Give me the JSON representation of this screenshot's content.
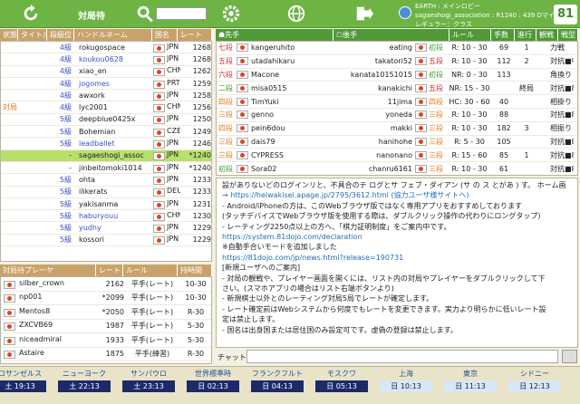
{
  "toolbar": {
    "title": "対局待",
    "status_line1": "EARTH : メインロビー",
    "status_line2": "sagaeshogi_association : R1240 : 439 Dマイル :",
    "status_line3": "レギュラー：クラス",
    "logo": "81"
  },
  "players_table": {
    "headers": [
      "状態",
      "タイトル",
      "段級位",
      "ハンドルネーム",
      "国名",
      "レート"
    ],
    "rows": [
      {
        "status": "",
        "title": "",
        "rank": "4級",
        "rank_color": "blue",
        "name": "rokugospace",
        "country": "JPN",
        "rate": "1268"
      },
      {
        "status": "",
        "title": "",
        "rank": "4級",
        "rank_color": "blue",
        "name": "koukou0628",
        "country": "JPN",
        "rate": "1268",
        "name_color": "blue"
      },
      {
        "status": "",
        "title": "",
        "rank": "4級",
        "rank_color": "blue",
        "name": "xiao_en",
        "country": "CHN",
        "rate": "1262"
      },
      {
        "status": "",
        "title": "",
        "rank": "4級",
        "rank_color": "blue",
        "name": "jogomes",
        "country": "PRT",
        "rate": "1259",
        "name_color": "blue"
      },
      {
        "status": "",
        "title": "",
        "rank": "4級",
        "rank_color": "blue",
        "name": "awxork",
        "country": "JPN",
        "rate": "1258"
      },
      {
        "status": "対局",
        "title": "",
        "rank": "4級",
        "rank_color": "blue",
        "name": "lyc2001",
        "country": "CHN",
        "rate": "1256"
      },
      {
        "status": "",
        "title": "",
        "rank": "5級",
        "rank_color": "blue",
        "name": "deepblue0425x",
        "country": "JPN",
        "rate": "1250"
      },
      {
        "status": "",
        "title": "",
        "rank": "5級",
        "rank_color": "blue",
        "name": "Bohemian",
        "country": "CZE",
        "rate": "1249"
      },
      {
        "status": "",
        "title": "",
        "rank": "5級",
        "rank_color": "blue",
        "name": "leadballet",
        "country": "JPN",
        "rate": "1246",
        "name_color": "blue"
      },
      {
        "status": "",
        "title": "",
        "rank": "-",
        "rank_color": "none",
        "name": "sagaeshogi_assoc",
        "country": "JPN",
        "rate": "*1240",
        "selected": true
      },
      {
        "status": "",
        "title": "",
        "rank": "-",
        "rank_color": "none",
        "name": "jinbeitomoki1014",
        "country": "JPN",
        "rate": "*1240"
      },
      {
        "status": "",
        "title": "",
        "rank": "5級",
        "rank_color": "blue",
        "name": "ohta",
        "country": "JPN",
        "rate": "1233"
      },
      {
        "status": "",
        "title": "",
        "rank": "5級",
        "rank_color": "blue",
        "name": "ilikerats",
        "country": "DEU",
        "rate": "1233"
      },
      {
        "status": "",
        "title": "",
        "rank": "5級",
        "rank_color": "blue",
        "name": "yakisanma",
        "country": "JPN",
        "rate": "1231"
      },
      {
        "status": "",
        "title": "",
        "rank": "5級",
        "rank_color": "blue",
        "name": "haburyouu",
        "country": "CHN",
        "rate": "1230",
        "name_color": "blue"
      },
      {
        "status": "",
        "title": "",
        "rank": "5級",
        "rank_color": "blue",
        "name": "yudhy",
        "country": "JPN",
        "rate": "1229",
        "name_color": "blue"
      },
      {
        "status": "",
        "title": "",
        "rank": "5級",
        "rank_color": "blue",
        "name": "kossori",
        "country": "JPN",
        "rate": "1229"
      }
    ]
  },
  "waiting_table": {
    "headers": [
      "対局待プレーヤ",
      "レート",
      "ルール",
      "持時間"
    ],
    "rows": [
      {
        "name": "silber_crown",
        "rate": "2162",
        "rule": "平手(レート)",
        "time": "10-30"
      },
      {
        "name": "np001",
        "rate": "*2099",
        "rule": "平手(レート)",
        "time": "10-30"
      },
      {
        "name": "Mentos8",
        "rate": "*2050",
        "rule": "平手(レート)",
        "time": "R-30"
      },
      {
        "name": "ZXCVB69",
        "rate": "1987",
        "rule": "平手(レート)",
        "time": "5-30"
      },
      {
        "name": "niceadmiral",
        "rate": "1933",
        "rule": "平手(レート)",
        "time": "5-30"
      },
      {
        "name": "Astaire",
        "rate": "1875",
        "rule": "平手(練習)",
        "time": "R-30"
      }
    ]
  },
  "games_table": {
    "headers": [
      "☗先手",
      "☖後手",
      "ルール",
      "手数",
      "進行",
      "観戦",
      "戦型"
    ],
    "rows": [
      {
        "b_rank": "七段",
        "b_color": "red",
        "b_name": "kangeruhito",
        "w_name": "eating",
        "w_rank": "初段",
        "w_color": "green",
        "rule": "R: 10 - 30",
        "moves": "69",
        "prog": "1",
        "watch": "",
        "style": "力戦"
      },
      {
        "b_rank": "五段",
        "b_color": "red",
        "b_name": "utadahikaru",
        "w_name": "takatori52",
        "w_rank": "五段",
        "w_color": "red",
        "rule": "R: 10 - 30",
        "moves": "112",
        "prog": "2",
        "watch": "",
        "style": "対抗■中"
      },
      {
        "b_rank": "六段",
        "b_color": "red",
        "b_name": "Macone",
        "w_name": "kanata10151015",
        "w_rank": "初段",
        "w_color": "green",
        "rule": "NR: 0 - 30",
        "moves": "113",
        "prog": "",
        "watch": "",
        "style": "角換り"
      },
      {
        "b_rank": "二段",
        "b_color": "green",
        "b_name": "misa0515",
        "w_name": "kanakichi",
        "w_rank": "五段",
        "w_color": "red",
        "rule": "NR: 15 - 30",
        "moves": "",
        "prog": "終局",
        "watch": "",
        "style": "対抗■8"
      },
      {
        "b_rank": "四段",
        "b_color": "orange",
        "b_name": "TimYuki",
        "w_name": "11jima",
        "w_rank": "四段",
        "w_color": "orange",
        "rule": "HC: 30 - 60",
        "moves": "40",
        "prog": "",
        "watch": "",
        "style": "相掛り"
      },
      {
        "b_rank": "三段",
        "b_color": "orange",
        "b_name": "genno",
        "w_name": "yoneda",
        "w_rank": "三段",
        "w_color": "orange",
        "rule": "R: 10 - 30",
        "moves": "88",
        "prog": "",
        "watch": "",
        "style": "対抗■8"
      },
      {
        "b_rank": "四段",
        "b_color": "orange",
        "b_name": "pein6dou",
        "w_name": "makki",
        "w_rank": "三段",
        "w_color": "orange",
        "rule": "R: 10 - 30",
        "moves": "182",
        "prog": "3",
        "watch": "",
        "style": "相振り"
      },
      {
        "b_rank": "三段",
        "b_color": "orange",
        "b_name": "dais79",
        "w_name": "hanihohe",
        "w_rank": "三段",
        "w_color": "orange",
        "rule": "R: 5 - 30",
        "moves": "105",
        "prog": "",
        "watch": "",
        "style": "対抗■8"
      },
      {
        "b_rank": "三段",
        "b_color": "orange",
        "b_name": "CYPRESS",
        "w_name": "nanonano",
        "w_rank": "三段",
        "w_color": "orange",
        "rule": "R: 15 - 60",
        "moves": "85",
        "prog": "1",
        "watch": "",
        "style": "対抗■8"
      },
      {
        "b_rank": "初段",
        "b_color": "green",
        "b_name": "Sora02",
        "w_name": "chanru6161",
        "w_rank": "三段",
        "w_color": "orange",
        "rule": "R: 10 - 30",
        "moves": "61",
        "prog": "",
        "watch": "",
        "style": "対抗■8"
      }
    ]
  },
  "info_lines": [
    {
      "text": "設がありないどのログインリと、不具合のテ ログとサ フェブ・ダイアン (サ の ス とがあ ) す。 ホーム画",
      "link": false
    },
    {
      "text": "→ https://heiwakisei.apage.jp/2795/3612.html (協力ユーザ様サイトへ)",
      "link": true
    },
    {
      "text": "- Android/iPhoneの方は、このWebブラウザ版ではなく専用アプリをおすすめしております",
      "link": false
    },
    {
      "text": "(タッチデバイスでWebブラウザ版を使用する際は、ダブルクリック操作の代わりにロングタップ)",
      "link": false
    },
    {
      "text": "- レーティング2250点以上の方へ、「棋力証明制度」をご案内中です。",
      "link": false
    },
    {
      "text": "https://system.81dojo.com/declaration",
      "link": true
    },
    {
      "text": "※自動手合いモードを追加しました",
      "link": false
    },
    {
      "text": "https://81dojo.com/jp/news.html?release=190731",
      "link": true
    },
    {
      "text": "[新規ユーザへのご案内]",
      "link": false
    },
    {
      "text": "- 対局の観戦や、プレイヤー画面を開くには、リスト内の対局やプレイヤーをダブルクリックして下",
      "link": false
    },
    {
      "text": "さい。(スマホアプリの場合はリスト右端ボタンより)",
      "link": false
    },
    {
      "text": "- 新規棋士以外とのレーティング対局5局でレートが確定します。",
      "link": false
    },
    {
      "text": "- レート確定前はWebシステムから何度でもレートを変更できます。実力より明らかに低いレート設",
      "link": false
    },
    {
      "text": "定は禁止します。",
      "link": false
    },
    {
      "text": "- 国名は出身国または居住国のみ設定可です。虚偽の登録は禁止します。",
      "link": false
    }
  ],
  "chat": {
    "label": "チャット"
  },
  "clocks": [
    {
      "city": "ロサンゼルス",
      "time": "土 19:13",
      "light": false
    },
    {
      "city": "ニューヨーク",
      "time": "土 22:13",
      "light": false
    },
    {
      "city": "サンパウロ",
      "time": "土 23:13",
      "light": false
    },
    {
      "city": "世界標準時",
      "time": "日 02:13",
      "light": false
    },
    {
      "city": "フランクフルト",
      "time": "日 04:13",
      "light": false
    },
    {
      "city": "モスクワ",
      "time": "日 05:13",
      "light": false
    },
    {
      "city": "上海",
      "time": "日 10:13",
      "light": true
    },
    {
      "city": "東京",
      "time": "日 11:13",
      "light": true
    },
    {
      "city": "シドニー",
      "time": "日 12:13",
      "light": true
    }
  ]
}
